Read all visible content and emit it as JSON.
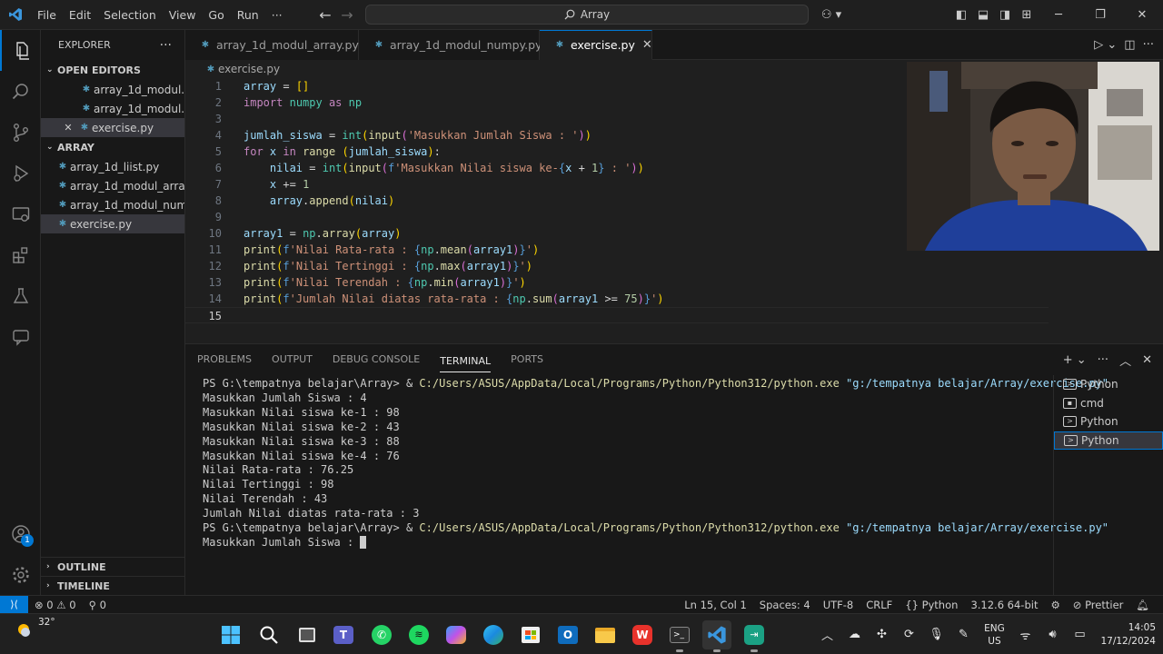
{
  "titlebar": {
    "menus": [
      "File",
      "Edit",
      "Selection",
      "View",
      "Go",
      "Run",
      "···"
    ],
    "search_text": "Array"
  },
  "sidebar": {
    "header": "EXPLORER",
    "open_editors_label": "OPEN EDITORS",
    "open_editors": [
      "array_1d_modul...",
      "array_1d_modul...",
      "exercise.py"
    ],
    "folder_label": "ARRAY",
    "files": [
      "array_1d_liist.py",
      "array_1d_modul_array...",
      "array_1d_modul_num...",
      "exercise.py"
    ],
    "outline_label": "OUTLINE",
    "timeline_label": "TIMELINE",
    "account_badge": "1"
  },
  "tabs": [
    {
      "label": "array_1d_modul_array.py"
    },
    {
      "label": "array_1d_modul_numpy.py"
    },
    {
      "label": "exercise.py"
    }
  ],
  "breadcrumb": "exercise.py",
  "code": {
    "line_numbers": [
      "1",
      "2",
      "3",
      "4",
      "5",
      "6",
      "7",
      "8",
      "9",
      "10",
      "11",
      "12",
      "13",
      "14",
      "15"
    ]
  },
  "panel": {
    "tabs": [
      "PROBLEMS",
      "OUTPUT",
      "DEBUG CONSOLE",
      "TERMINAL",
      "PORTS"
    ],
    "prompt": "PS G:\\tempatnya belajar\\Array> ",
    "command_sep": "& ",
    "python_path": "C:/Users/ASUS/AppData/Local/Programs/Python/Python312/python.exe",
    "script_arg": "\"g:/tempatnya belajar/Array/exercise.py\"",
    "output_lines": [
      "Masukkan Jumlah Siswa : 4",
      "Masukkan Nilai siswa ke-1 : 98",
      "Masukkan Nilai siswa ke-2 : 43",
      "Masukkan Nilai siswa ke-3 : 88",
      "Masukkan Nilai siswa ke-4 : 76",
      "Nilai Rata-rata : 76.25",
      "Nilai Tertinggi : 98",
      "Nilai Terendah : 43",
      "Jumlah Nilai diatas rata-rata : 3"
    ],
    "last_line": "Masukkan Jumlah Siswa : ",
    "terminals": [
      "Python",
      "cmd",
      "Python",
      "Python"
    ]
  },
  "statusbar": {
    "errors": "0",
    "warnings": "0",
    "ports": "0",
    "position": "Ln 15, Col 1",
    "spaces": "Spaces: 4",
    "encoding": "UTF-8",
    "eol": "CRLF",
    "language": "Python",
    "interpreter": "3.12.6 64-bit",
    "formatter": "Prettier"
  },
  "taskbar": {
    "temperature": "32°",
    "lang_line1": "ENG",
    "lang_line2": "US",
    "time": "14:05",
    "date": "17/12/2024"
  },
  "colors": {
    "accent": "#0078d4",
    "editor_bg": "#1f1f1f",
    "sidebar_bg": "#181818"
  }
}
